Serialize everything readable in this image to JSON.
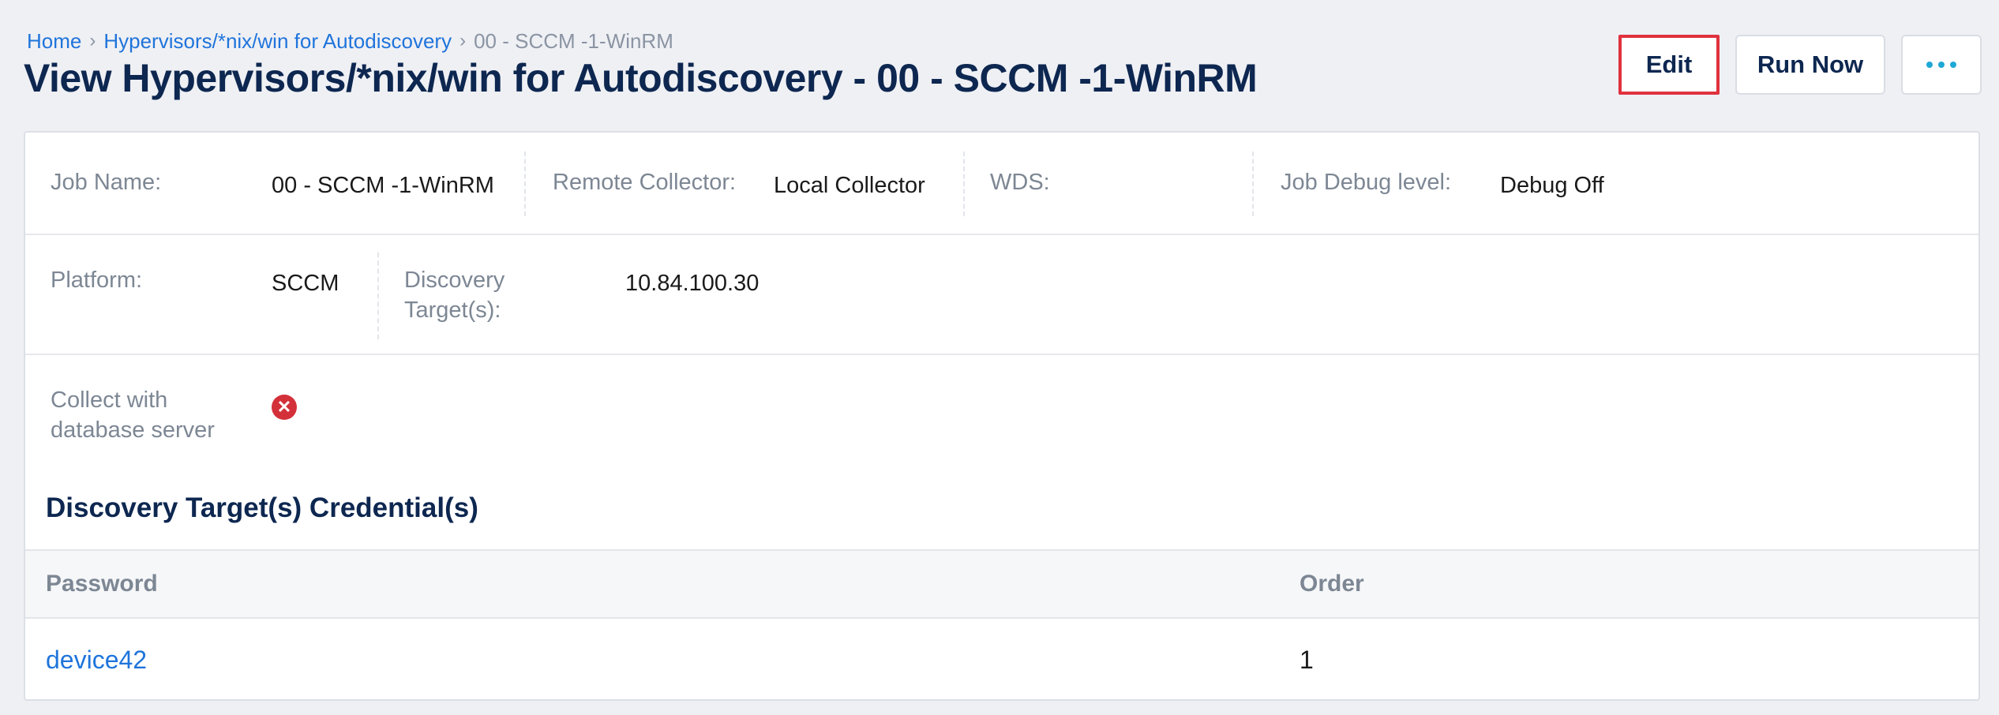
{
  "breadcrumb": {
    "home": "Home",
    "sep": "›",
    "section": "Hypervisors/*nix/win for Autodiscovery",
    "current": "00 - SCCM -1-WinRM"
  },
  "page_title": "View Hypervisors/*nix/win for Autodiscovery - 00 - SCCM -1-WinRM",
  "actions": {
    "edit": "Edit",
    "run_now": "Run Now",
    "more_icon": "more-horizontal-icon"
  },
  "details": {
    "job_name": {
      "label": "Job Name:",
      "value": "00 - SCCM -1-WinRM"
    },
    "remote_collector": {
      "label": "Remote Collector:",
      "value": "Local Collector"
    },
    "wds": {
      "label": "WDS:",
      "value": ""
    },
    "job_debug_level": {
      "label": "Job Debug level:",
      "value": "Debug Off"
    },
    "platform": {
      "label": "Platform:",
      "value": "SCCM"
    },
    "discovery_targets": {
      "label_line1": "Discovery",
      "label_line2": "Target(s):",
      "value": "10.84.100.30"
    },
    "collect_with_db": {
      "label_line1": "Collect with",
      "label_line2": "database server",
      "status_icon": "x-circle-icon",
      "status_color": "#d3303a"
    }
  },
  "credentials": {
    "title": "Discovery Target(s) Credential(s)",
    "columns": [
      "Password",
      "Order"
    ],
    "rows": [
      {
        "password": "device42",
        "order": "1"
      }
    ]
  },
  "colors": {
    "title": "#0d2750",
    "link": "#1f74db",
    "edit_highlight": "#e0323e",
    "dots": "#1fa8d6"
  }
}
